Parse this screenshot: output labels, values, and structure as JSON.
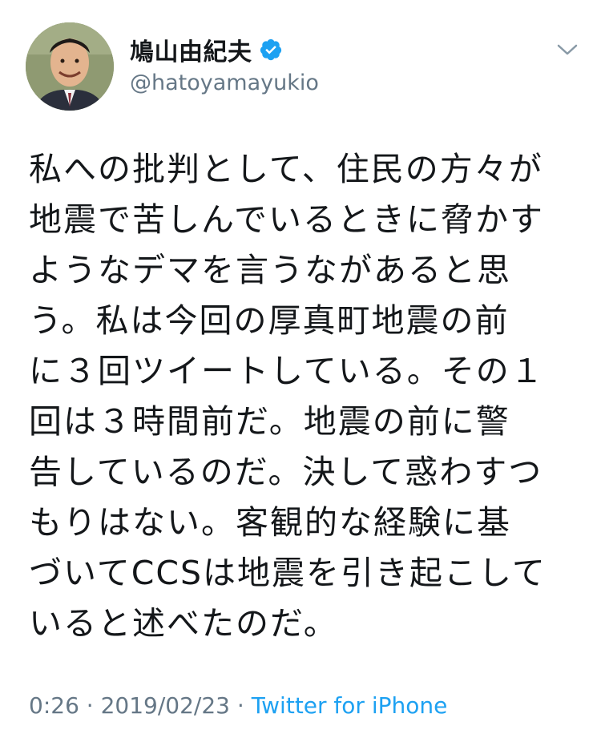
{
  "author": {
    "display_name": "鳩山由紀夫",
    "handle": "@hatoyamayukio",
    "verified": true,
    "avatar_icon": "profile-photo"
  },
  "tweet": {
    "lines": [
      "私への批判として、住民の方々が",
      "地震で苦しんでいるときに脅かす",
      "ようなデマを言うながあると思",
      "う。私は今回の厚真町地震の前",
      "に３回ツイートしている。その１",
      "回は３時間前だ。地震の前に警",
      "告しているのだ。決して惑わすつ",
      "もりはない。客観的な経験に基",
      "づいてCCSは地震を引き起こして",
      "いると述べたのだ。"
    ]
  },
  "meta": {
    "time": "0:26",
    "separator1": " · ",
    "date": "2019/02/23",
    "separator2": " · ",
    "source": "Twitter for iPhone"
  },
  "colors": {
    "text": "#14171a",
    "secondary": "#657786",
    "link": "#1da1f2",
    "verified_badge": "#1da1f2"
  }
}
